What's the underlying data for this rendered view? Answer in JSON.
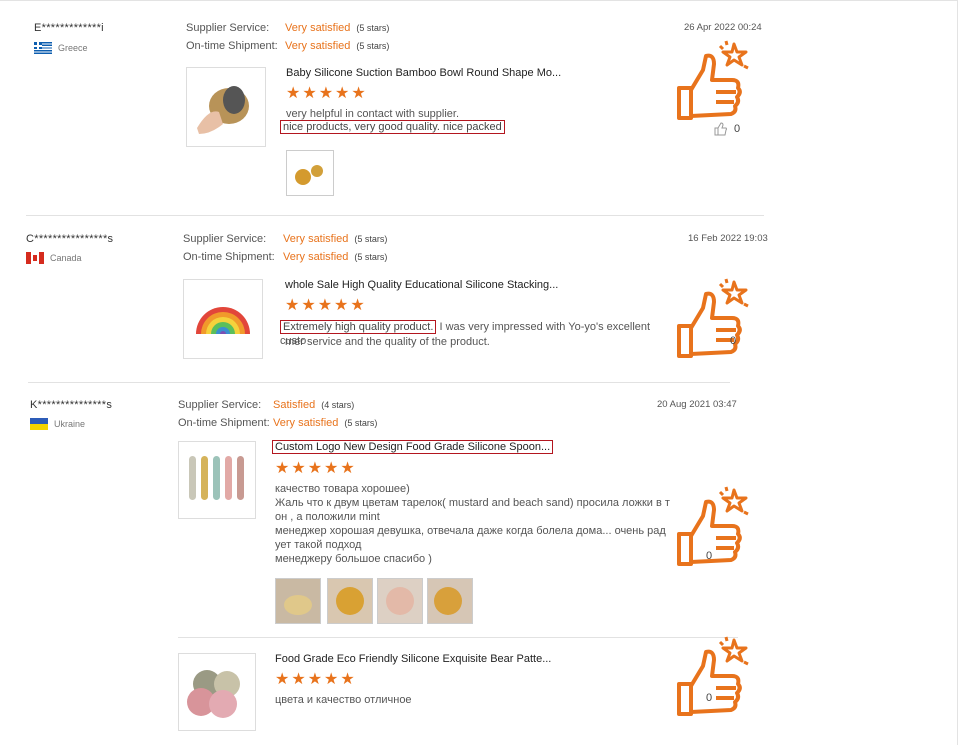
{
  "reviews": [
    {
      "reviewer": "E*************i",
      "country": "Greece",
      "supplier_label": "Supplier Service:",
      "supplier_value": "Very satisfied",
      "supplier_stars": "(5 stars)",
      "shipment_label": "On-time Shipment:",
      "shipment_value": "Very satisfied",
      "shipment_stars": "(5 stars)",
      "date": "26 Apr 2022 00:24",
      "product_title": "Baby Silicone Suction Bamboo Bowl Round Shape Mo...",
      "rating": "★★★★★",
      "line1": "very helpful in contact with supplier.",
      "line2_boxed": "nice products, very good quality. nice packed",
      "likes": "0"
    },
    {
      "reviewer": "C****************s",
      "country": "Canada",
      "supplier_label": "Supplier Service:",
      "supplier_value": "Very satisfied",
      "supplier_stars": "(5 stars)",
      "shipment_label": "On-time Shipment:",
      "shipment_value": "Very satisfied",
      "shipment_stars": "(5 stars)",
      "date": "16 Feb 2022 19:03",
      "product_title": "whole Sale High Quality Educational Silicone Stacking...",
      "rating": "★★★★★",
      "boxed": "Extremely high quality product.",
      "rest1": " I was very impressed with Yo-yo's excellent custo",
      "rest2": "mer service and the quality of the product.",
      "likes": "0"
    },
    {
      "reviewer": "K***************s",
      "country": "Ukraine",
      "supplier_label": "Supplier Service:",
      "supplier_value": "Satisfied",
      "supplier_stars": "(4 stars)",
      "shipment_label": "On-time Shipment:",
      "shipment_value": "Very satisfied",
      "shipment_stars": "(5 stars)",
      "date": "20 Aug 2021 03:47",
      "product_title": "Custom Logo New Design Food Grade Silicone Spoon...",
      "rating": "★★★★★",
      "lines": [
        "качество товара хорошее)",
        "Жаль что к двум цветам тарелок( mustard and beach sand) просила ложки в т",
        "он , а положили mint",
        "менеджер хорошая девушка, отвечала даже когда болела дома... очень рад",
        "ует такой подход",
        "менеджеру большое спасибо )"
      ],
      "likes": "0",
      "product2_title": "Food Grade Eco Friendly Silicone Exquisite Bear Patte...",
      "rating2": "★★★★★",
      "text2": "цвета и качество отличное",
      "likes2": "0"
    }
  ],
  "colors": {
    "accent": "#e8731c",
    "highlight_box": "#b3161f"
  },
  "icons": [
    "thumbs-up-star-icon",
    "like-icon"
  ]
}
